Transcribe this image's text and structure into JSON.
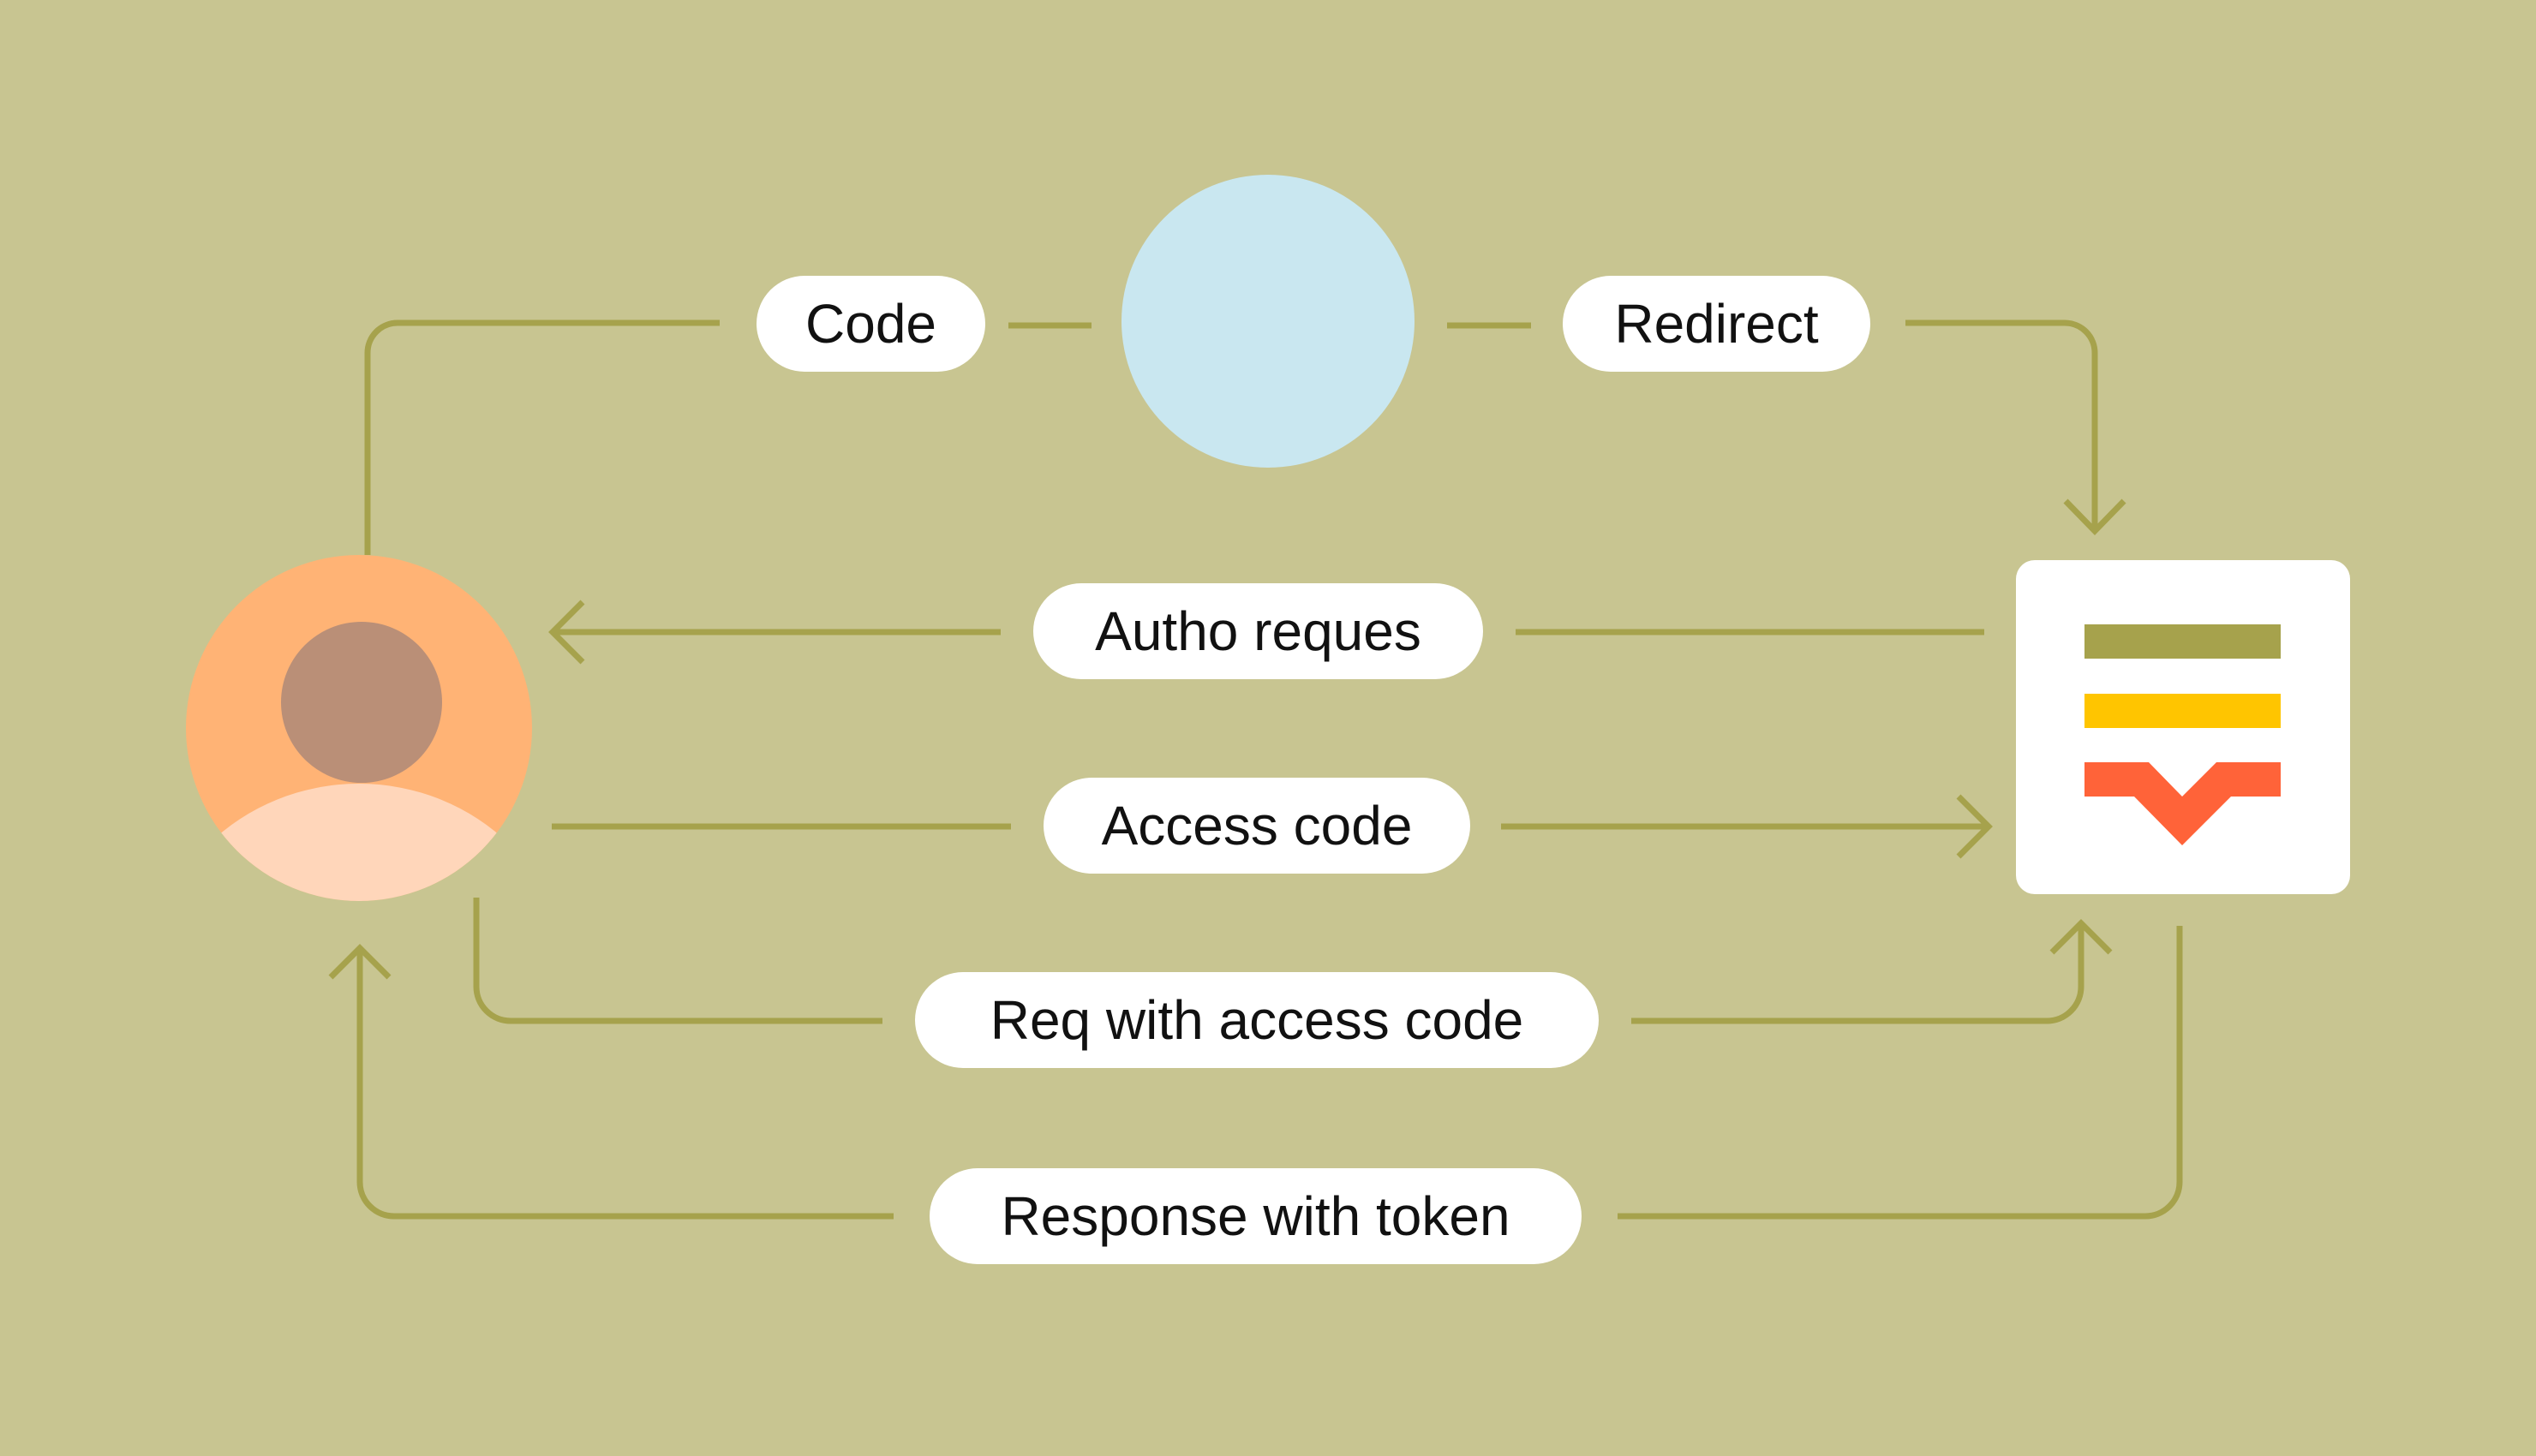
{
  "diagram": {
    "type": "oauth-authorization-code-flow",
    "actors": {
      "user": {
        "icon": "user-avatar-icon"
      },
      "browser": {
        "icon": "globe-icon"
      },
      "server": {
        "icon": "server-document-icon"
      }
    },
    "flows": [
      {
        "id": "code",
        "label": "Code",
        "from": "user",
        "to": "browser"
      },
      {
        "id": "redirect",
        "label": "Redirect",
        "from": "browser",
        "to": "server"
      },
      {
        "id": "autho-request",
        "label": "Autho reques",
        "from": "server",
        "to": "user"
      },
      {
        "id": "access-code",
        "label": "Access code",
        "from": "user",
        "to": "server"
      },
      {
        "id": "req-with-access-code",
        "label": "Req with access code",
        "from": "user",
        "to": "server"
      },
      {
        "id": "response-with-token",
        "label": "Response with token",
        "from": "server",
        "to": "user"
      }
    ]
  },
  "colors": {
    "background": "#C8C591",
    "connector": "#A6A24C",
    "pill": "#FFFFFF",
    "text": "#111111",
    "globe_ocean": "#C9E7F0",
    "globe_land": "#A6A24C",
    "avatar_bg": "#FFB375",
    "avatar_head": "#BA8F77",
    "avatar_body": "#FFD6BA",
    "server_bg": "#FFFFFF",
    "server_bar_1": "#A6A24C",
    "server_bar_2": "#FFC500",
    "server_bar_3": "#FF6339"
  }
}
